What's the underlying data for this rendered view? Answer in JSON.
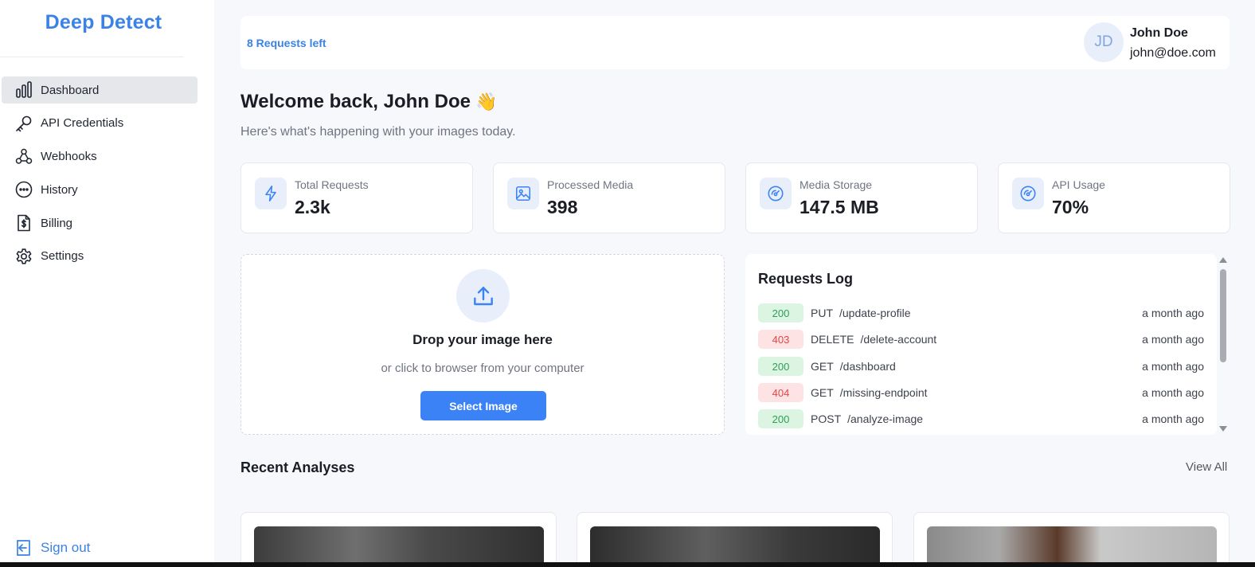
{
  "brand": {
    "title": "Deep Detect"
  },
  "sidebar": {
    "items": [
      {
        "label": "Dashboard",
        "icon": "bar-chart-icon",
        "active": true
      },
      {
        "label": "API Credentials",
        "icon": "key-icon"
      },
      {
        "label": "Webhooks",
        "icon": "webhook-icon"
      },
      {
        "label": "History",
        "icon": "ellipsis-circle-icon"
      },
      {
        "label": "Billing",
        "icon": "invoice-dollar-icon"
      },
      {
        "label": "Settings",
        "icon": "gear-icon"
      }
    ],
    "signout_label": "Sign out"
  },
  "topbar": {
    "requests_left": "8 Requests left",
    "user": {
      "initials": "JD",
      "name": "John Doe",
      "email": "john@doe.com"
    }
  },
  "welcome": {
    "title": "Welcome back, John Doe",
    "emoji": "👋",
    "subtitle": "Here's what's happening with your images today."
  },
  "stats": [
    {
      "label": "Total Requests",
      "value": "2.3k",
      "icon": "lightning-icon"
    },
    {
      "label": "Processed Media",
      "value": "398",
      "icon": "image-icon"
    },
    {
      "label": "Media Storage",
      "value": "147.5 MB",
      "icon": "gauge-icon"
    },
    {
      "label": "API Usage",
      "value": "70%",
      "icon": "gauge-icon"
    }
  ],
  "upload": {
    "title": "Drop your image here",
    "subtitle": "or click to browser from your computer",
    "button_label": "Select Image"
  },
  "requests_log": {
    "title": "Requests Log",
    "rows": [
      {
        "status": "200",
        "method": "PUT",
        "path": "/update-profile",
        "time": "a month ago"
      },
      {
        "status": "403",
        "method": "DELETE",
        "path": "/delete-account",
        "time": "a month ago"
      },
      {
        "status": "200",
        "method": "GET",
        "path": "/dashboard",
        "time": "a month ago"
      },
      {
        "status": "404",
        "method": "GET",
        "path": "/missing-endpoint",
        "time": "a month ago"
      },
      {
        "status": "200",
        "method": "POST",
        "path": "/analyze-image",
        "time": "a month ago"
      }
    ]
  },
  "recent": {
    "title": "Recent Analyses",
    "view_all": "View All"
  },
  "colors": {
    "accent": "#3b82f6",
    "success_bg": "#dcf5e3",
    "error_bg": "#fde3e3"
  }
}
